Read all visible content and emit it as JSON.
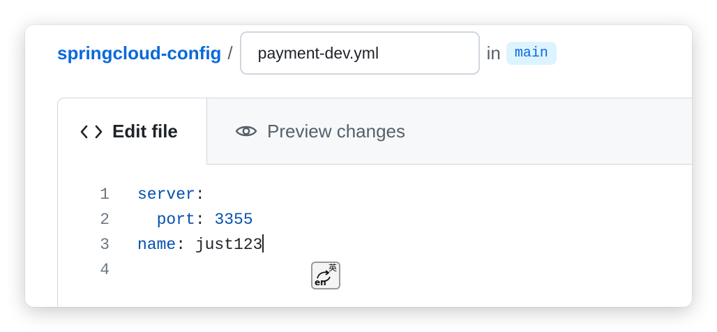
{
  "header": {
    "repo_name": "springcloud-config",
    "separator": "/",
    "filename_value": "payment-dev.yml",
    "in_label": "in",
    "branch": "main"
  },
  "tabs": {
    "edit_label": "Edit file",
    "preview_label": "Preview changes"
  },
  "editor": {
    "line_numbers": [
      "1",
      "2",
      "3",
      "4"
    ],
    "lines": [
      {
        "key": "server",
        "colon": ":",
        "value": ""
      },
      {
        "indent": "  ",
        "key": "port",
        "colon": ": ",
        "value": "3355"
      },
      {
        "key": "name",
        "colon": ": ",
        "value": "just123"
      }
    ]
  },
  "ime": {
    "top": "英",
    "bottom": "en"
  },
  "colors": {
    "link": "#0969da",
    "yaml_key": "#0550ae",
    "badge_bg": "#ddf4ff"
  }
}
